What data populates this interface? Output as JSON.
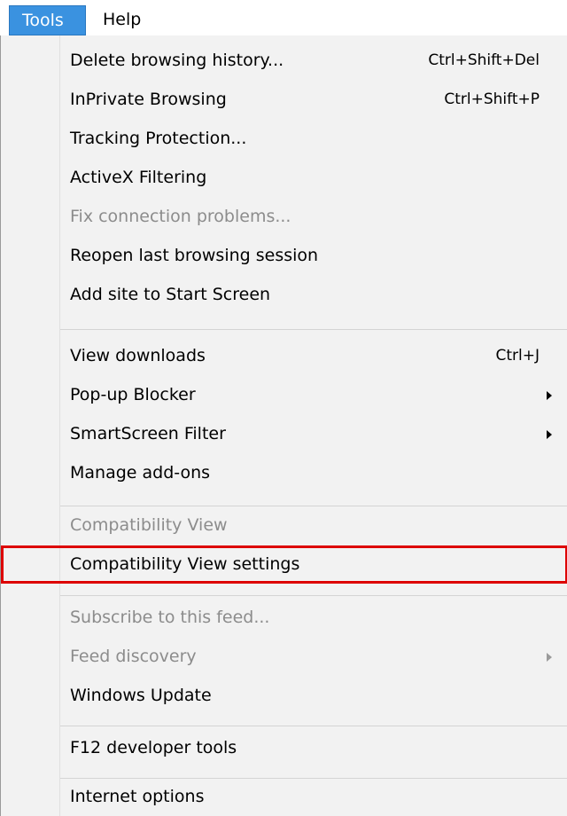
{
  "menubar": {
    "items": [
      {
        "label": "Tools",
        "active": true
      },
      {
        "label": "Help",
        "active": false
      }
    ]
  },
  "menu": {
    "groups": [
      [
        {
          "label": "Delete browsing history...",
          "shortcut": "Ctrl+Shift+Del",
          "enabled": true
        },
        {
          "label": "InPrivate Browsing",
          "shortcut": "Ctrl+Shift+P",
          "enabled": true
        },
        {
          "label": "Tracking Protection...",
          "enabled": true
        },
        {
          "label": "ActiveX Filtering",
          "enabled": true
        },
        {
          "label": "Fix connection problems...",
          "enabled": false
        },
        {
          "label": "Reopen last browsing session",
          "enabled": true
        },
        {
          "label": "Add site to Start Screen",
          "enabled": true
        }
      ],
      [
        {
          "label": "View downloads",
          "shortcut": "Ctrl+J",
          "enabled": true
        },
        {
          "label": "Pop-up Blocker",
          "submenu": true,
          "enabled": true
        },
        {
          "label": "SmartScreen Filter",
          "submenu": true,
          "enabled": true
        },
        {
          "label": "Manage add-ons",
          "enabled": true
        }
      ],
      [
        {
          "label": "Compatibility View",
          "enabled": false
        },
        {
          "label": "Compatibility View settings",
          "enabled": true,
          "highlighted": true
        }
      ],
      [
        {
          "label": "Subscribe to this feed...",
          "enabled": false
        },
        {
          "label": "Feed discovery",
          "submenu": true,
          "enabled": false
        },
        {
          "label": "Windows Update",
          "enabled": true
        }
      ],
      [
        {
          "label": "F12 developer tools",
          "enabled": true
        }
      ],
      [
        {
          "label": "Internet options",
          "enabled": true
        }
      ]
    ]
  },
  "colors": {
    "menubar_active_bg": "#3a92e0",
    "menu_bg": "#f2f2f2",
    "disabled_text": "#8c8c8c",
    "highlight_outline": "#dd0000"
  }
}
